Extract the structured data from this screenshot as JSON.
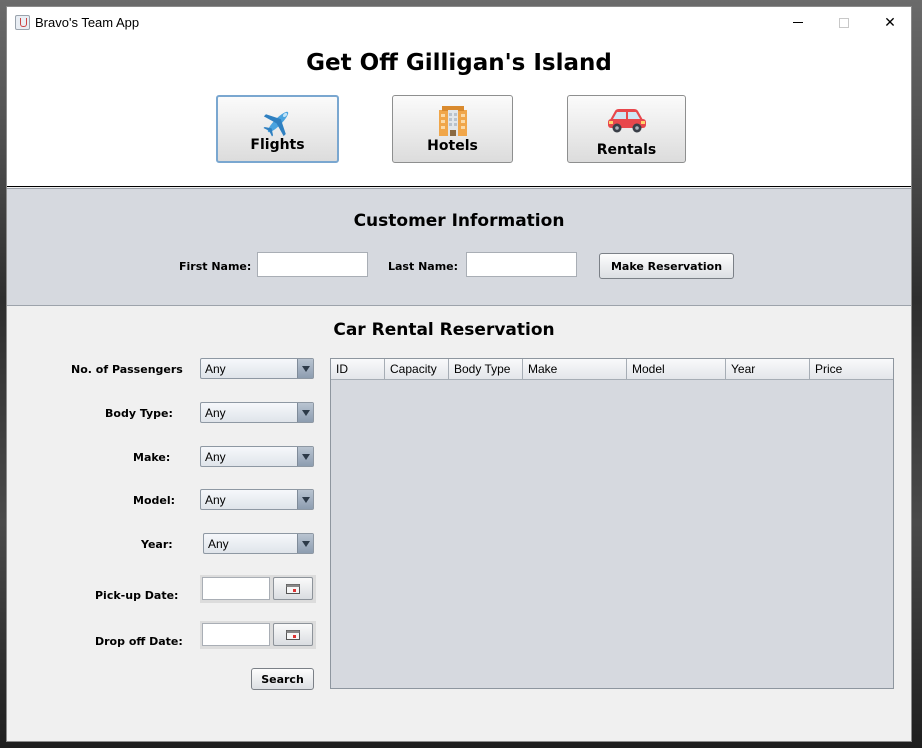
{
  "window": {
    "title": "Bravo's Team App",
    "controls": {
      "minimize": "—",
      "maximize": "☐",
      "close": "✕"
    }
  },
  "header": {
    "title": "Get Off Gilligan's Island",
    "nav": [
      {
        "label": "Flights",
        "icon": "airplane-icon",
        "active": true
      },
      {
        "label": "Hotels",
        "icon": "hotel-building-icon",
        "active": false
      },
      {
        "label": "Rentals",
        "icon": "car-icon",
        "active": false
      }
    ]
  },
  "customer": {
    "title": "Customer Information",
    "first_name_label": "First Name:",
    "first_name_value": "",
    "last_name_label": "Last Name:",
    "last_name_value": "",
    "reserve_button": "Make Reservation"
  },
  "rental": {
    "title": "Car Rental Reservation",
    "filters": {
      "passengers": {
        "label": "No. of Passengers",
        "value": "Any"
      },
      "body_type": {
        "label": "Body Type:",
        "value": "Any"
      },
      "make": {
        "label": "Make:",
        "value": "Any"
      },
      "model": {
        "label": "Model:",
        "value": "Any"
      },
      "year": {
        "label": "Year:",
        "value": "Any"
      },
      "pickup": {
        "label": "Pick-up Date:",
        "value": ""
      },
      "dropoff": {
        "label": "Drop off Date:",
        "value": ""
      }
    },
    "search_button": "Search",
    "table": {
      "columns": [
        "ID",
        "Capacity",
        "Body Type",
        "Make",
        "Model",
        "Year",
        "Price"
      ],
      "rows": []
    }
  },
  "colors": {
    "panel_gray": "#d6d9df",
    "window_bg": "#f0f0f0",
    "active_border": "#7aa7d0"
  }
}
